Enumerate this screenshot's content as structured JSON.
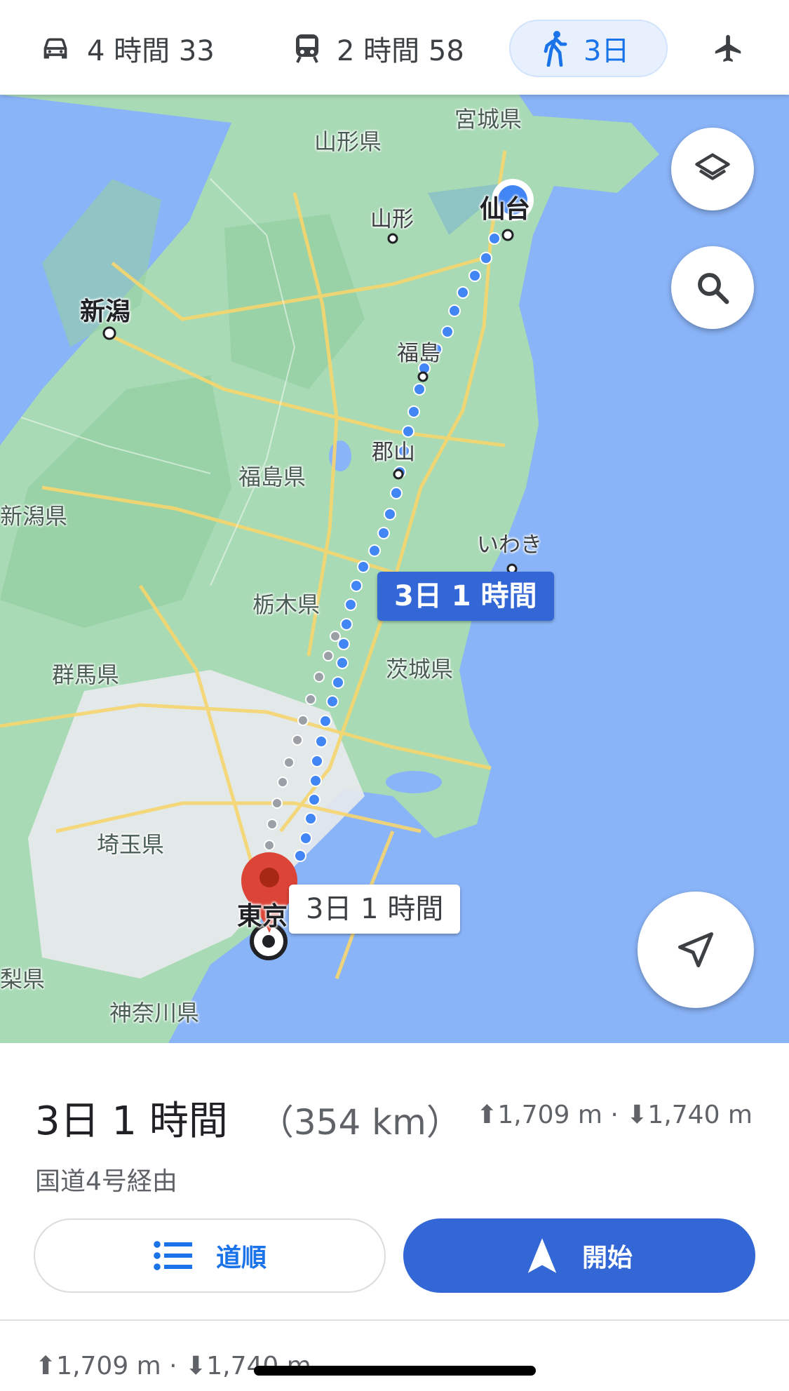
{
  "modes": {
    "drive": {
      "label": "4 時間 33",
      "icon": "car-icon"
    },
    "transit": {
      "label": "2 時間 58",
      "icon": "train-icon"
    },
    "walk": {
      "label": "3日",
      "icon": "walking-icon",
      "selected": true
    },
    "flight": {
      "icon": "airplane-icon"
    }
  },
  "map": {
    "labels": {
      "miyagi": "宮城県",
      "yamagata_pref": "山形県",
      "yamagata": "山形",
      "sendai": "仙台",
      "niigata": "新潟",
      "fukushima": "福島",
      "koriyama": "郡山",
      "fukushima_pref": "福島県",
      "niigata_pref": "新潟県",
      "iwaki": "いわき",
      "tochigi": "栃木県",
      "ibaraki": "茨城県",
      "gunma": "群馬県",
      "saitama": "埼玉県",
      "tokyo": "東京",
      "yamanashi": "梨県",
      "kanagawa": "神奈川県"
    },
    "route_bubble_primary": "3日 1 時間",
    "route_bubble_alt": "3日 1 時間",
    "controls": {
      "layers": "layers-icon",
      "search": "search-icon",
      "locate": "navigation-arrow-icon"
    },
    "colors": {
      "water": "#8ab4f8",
      "land": "#a8dab5",
      "route": "#4285f4",
      "alt_route": "#9aa0a6",
      "pin": "#db4437"
    }
  },
  "sheet": {
    "duration": "3日 1 時間",
    "distance": "（354 km）",
    "elevation": "⬆1,709 m · ⬇1,740 m",
    "via": "国道4号経由",
    "steps_label": "道順",
    "start_label": "開始",
    "elevation_repeat": "⬆1,709 m · ⬇1,740 m"
  }
}
